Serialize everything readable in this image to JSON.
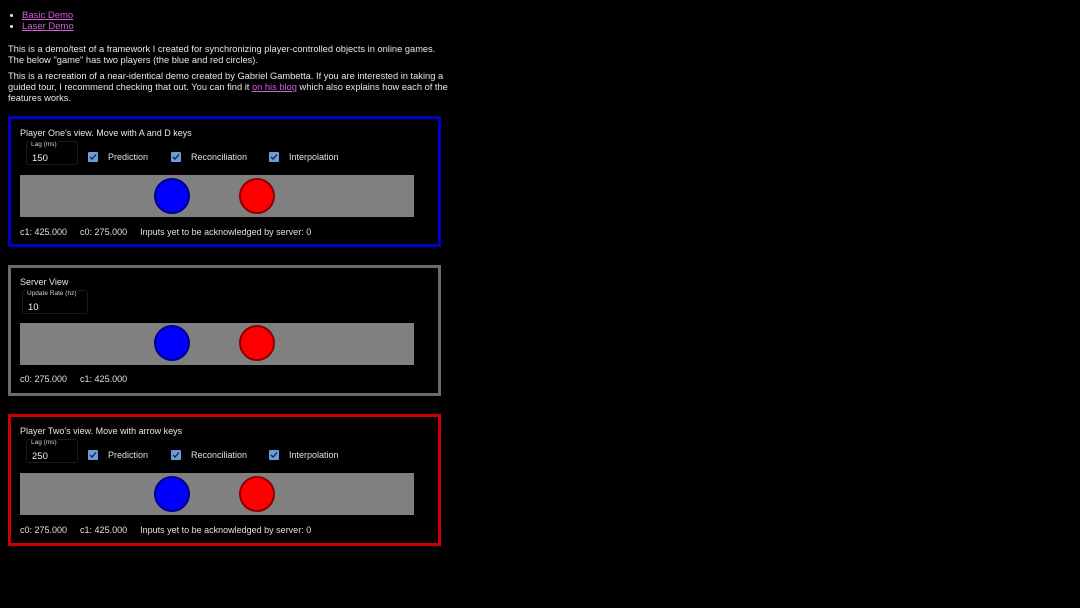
{
  "nav": {
    "links": [
      {
        "label": "Basic Demo"
      },
      {
        "label": "Laser Demo"
      }
    ]
  },
  "intro": {
    "paragraph1": "This is a demo/test of a framework I created for synchronizing player-controlled objects in online games. The below \"game\" has two players (the blue and red circles).",
    "paragraph2_before": "This is a recreation of a near-identical demo created by Gabriel Gambetta. If you are interested in taking a guided tour, I recommend checking that out. You can find it ",
    "paragraph2_link": "on his blog",
    "paragraph2_after": " which also explains how each of the features works."
  },
  "colors": {
    "player_one_border": "#0000c8",
    "server_border": "#6b6b6b",
    "player_two_border": "#cc0000",
    "link": "#d35ed6",
    "checkbox": "#6d9bd9",
    "canvas_bg": "#808080",
    "blue_player": "#0000ff",
    "red_player": "#ff0000"
  },
  "player_one": {
    "title": "Player One's view. Move with A and D keys",
    "lag_label": "Lag (ms)",
    "lag_value": "150",
    "options": [
      {
        "label": "Prediction",
        "checked": true
      },
      {
        "label": "Reconciliation",
        "checked": true
      },
      {
        "label": "Interpolation",
        "checked": true
      }
    ],
    "status": [
      "c1: 425.000",
      "c0: 275.000",
      "Inputs yet to be acknowledged by server: 0"
    ]
  },
  "server": {
    "title": "Server View",
    "rate_label": "Update Rate (hz)",
    "rate_value": "10",
    "status": [
      "c0: 275.000",
      "c1: 425.000"
    ]
  },
  "player_two": {
    "title": "Player Two's view. Move with arrow keys",
    "lag_label": "Lag (ms)",
    "lag_value": "250",
    "options": [
      {
        "label": "Prediction",
        "checked": true
      },
      {
        "label": "Reconciliation",
        "checked": true
      },
      {
        "label": "Interpolation",
        "checked": true
      }
    ],
    "status": [
      "c0: 275.000",
      "c1: 425.000",
      "Inputs yet to be acknowledged by server: 0"
    ]
  }
}
